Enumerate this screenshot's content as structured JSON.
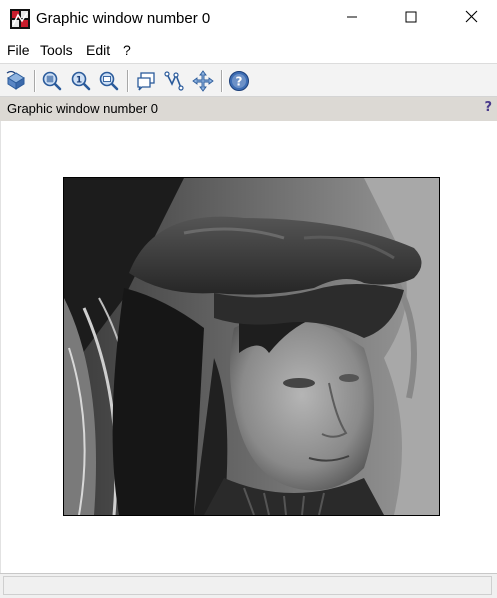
{
  "window": {
    "title": "Graphic window number 0",
    "app_icon": "scilab-graphics-icon",
    "controls": {
      "minimize": "minimize-icon",
      "maximize": "maximize-icon",
      "close": "close-icon"
    }
  },
  "menubar": {
    "items": [
      {
        "label": "File"
      },
      {
        "label": "Tools"
      },
      {
        "label": "Edit"
      },
      {
        "label": "?"
      }
    ]
  },
  "toolbar": {
    "buttons": [
      {
        "icon": "rotate-icon"
      },
      {
        "icon": "zoom-in-icon"
      },
      {
        "icon": "zoom-original-icon"
      },
      {
        "icon": "zoom-out-icon"
      },
      {
        "icon": "datatip-icon"
      },
      {
        "icon": "datatip-curve-icon"
      },
      {
        "icon": "pan-icon"
      },
      {
        "icon": "help-icon"
      }
    ]
  },
  "infobar": {
    "text": "Graphic window number 0",
    "help": "?"
  },
  "canvas": {
    "image": "grayscale-portrait-man-with-feathered-hat"
  },
  "statusbar": {
    "text": ""
  },
  "colors": {
    "infobar": "#dcd9d4",
    "toolbar": "#f3f3f3",
    "help_accent": "#4a3b8c"
  }
}
